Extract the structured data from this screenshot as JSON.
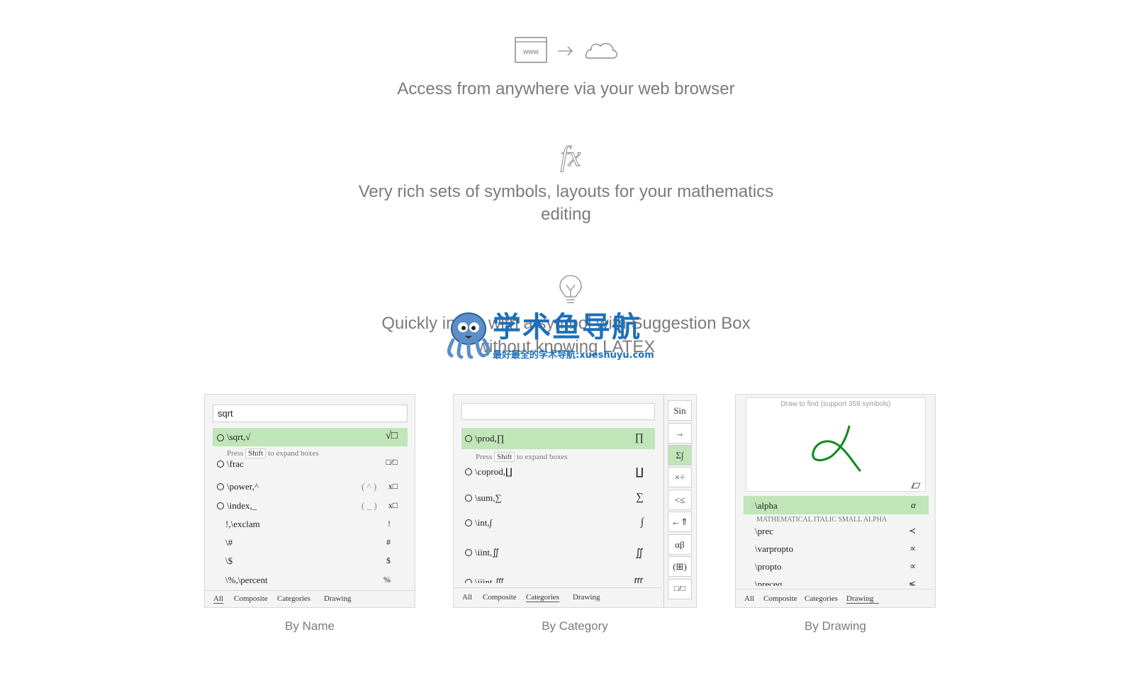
{
  "features": [
    {
      "icon": "browser-to-cloud-icon",
      "text": "Access from anywhere via your web browser"
    },
    {
      "icon": "fx-icon",
      "text_line1": "Very rich sets of symbols, layouts for your mathematics",
      "text_line2": "editing"
    },
    {
      "icon": "lightbulb-icon",
      "text_line1": "Quickly insert with a symbol with Suggestion Box",
      "text_line2": "without knowing LATEX"
    }
  ],
  "browser_icon_label": "www",
  "watermark": {
    "title": "学术鱼导航",
    "subtitle": "最好最全的学术导航:xueshuyu.com"
  },
  "by_name": {
    "search_value": "sqrt",
    "rows": [
      {
        "label": "\\sqrt,√",
        "glyph": "√□"
      },
      {
        "label": "\\frac",
        "glyph": "□⁄□"
      },
      {
        "label": "\\power,^",
        "shortcut": "( ^ )",
        "glyph": "x□"
      },
      {
        "label": "\\index,_",
        "shortcut": "( _ )",
        "glyph": "x□"
      },
      {
        "label": "!,\\exclam",
        "glyph": "!"
      },
      {
        "label": "\\#",
        "glyph": "#"
      },
      {
        "label": "\\$",
        "glyph": "$"
      },
      {
        "label": "\\%,\\percent",
        "glyph": "%"
      }
    ],
    "hint_press": "Press",
    "hint_key": "Shift",
    "hint_rest": "to expand boxes",
    "tabs": [
      "All",
      "Composite",
      "Categories",
      "Drawing"
    ],
    "caption": "By Name"
  },
  "by_category": {
    "search_value": "",
    "rows": [
      {
        "label": "\\prod,∏",
        "glyph": "∏"
      },
      {
        "label": "\\coprod,∐",
        "glyph": "∐"
      },
      {
        "label": "\\sum,∑",
        "glyph": "∑"
      },
      {
        "label": "\\int,∫",
        "glyph": "∫"
      },
      {
        "label": "\\iint,∬",
        "glyph": "∬"
      },
      {
        "label": "\\iiint,∭",
        "glyph": "∭"
      }
    ],
    "hint_press": "Press",
    "hint_key": "Shift",
    "hint_rest": "to expand boxes",
    "side_buttons": [
      "Sin",
      "→",
      "Σ∫",
      "×÷",
      "<≤",
      "←⇑",
      "αβ",
      "(⊞)",
      "□/□"
    ],
    "tabs": [
      "All",
      "Composite",
      "Categories",
      "Drawing"
    ],
    "caption": "By Category"
  },
  "by_drawing": {
    "canvas_hint": "Draw to find (support 359 symbols)",
    "rows": [
      {
        "label": "\\alpha",
        "glyph": "α"
      },
      {
        "label": "\\prec",
        "glyph": "≺"
      },
      {
        "label": "\\varpropto",
        "glyph": "∝"
      },
      {
        "label": "\\propto",
        "glyph": "∝"
      },
      {
        "label": "\\preceq",
        "glyph": "≼"
      }
    ],
    "alpha_desc": "MATHEMATICAL ITALIC SMALL ALPHA",
    "tabs": [
      "All",
      "Composite",
      "Categories",
      "Drawing"
    ],
    "caption": "By Drawing"
  },
  "colors": {
    "highlight": "#bfe5b9",
    "stroke": "#0b8a1a",
    "text": "#7b7b7b",
    "watermark_blue": "#1d6fb8",
    "watermark_magenta": "#b5188f"
  }
}
